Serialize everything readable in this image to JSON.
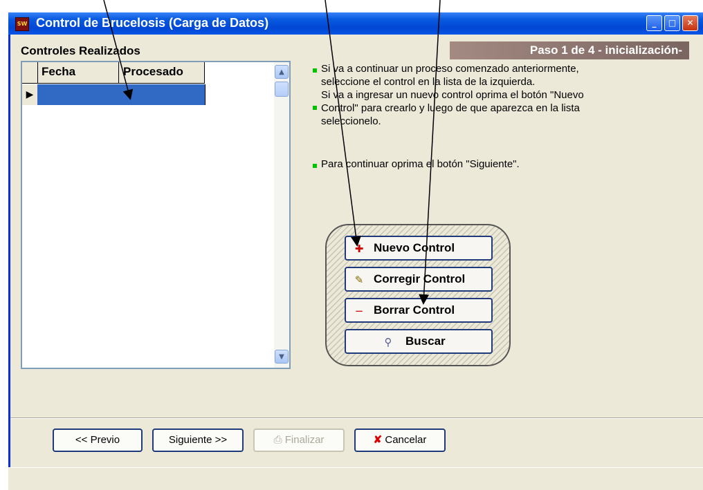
{
  "window": {
    "title": "Control de Brucelosis (Carga de Datos)",
    "controls": {
      "minimize": "_",
      "maximize": "□",
      "close": "✕"
    }
  },
  "left_panel": {
    "section_label": "Controles Realizados",
    "grid": {
      "columns": [
        "Fecha",
        "Procesado"
      ],
      "rows": [
        {
          "fecha": "",
          "procesado": ""
        }
      ]
    }
  },
  "step_banner": "Paso 1 de 4  - inicialización-",
  "instructions": [
    "Si va a continuar un proceso comenzado anteriormente,",
    "seleccione el control en la lista de la izquierda.",
    "Si va a ingresar un nuevo control oprima el botón \"Nuevo",
    "Control\" para crearlo y luego de que aparezca en la lista",
    "seleccionelo.",
    "Para continuar oprima el botón \"Siguiente\"."
  ],
  "action_buttons": {
    "nuevo": "Nuevo Control",
    "corregir": "Corregir Control",
    "borrar": "Borrar Control",
    "buscar": "Buscar"
  },
  "nav_buttons": {
    "previo": "<< Previo",
    "siguiente": "Siguiente >>",
    "finalizar": "Finalizar",
    "cancelar": "Cancelar"
  },
  "colors": {
    "titlebar": "#0a5be0",
    "selection": "#316ac5",
    "banner": "#8c7570",
    "bullet": "#00c000"
  }
}
